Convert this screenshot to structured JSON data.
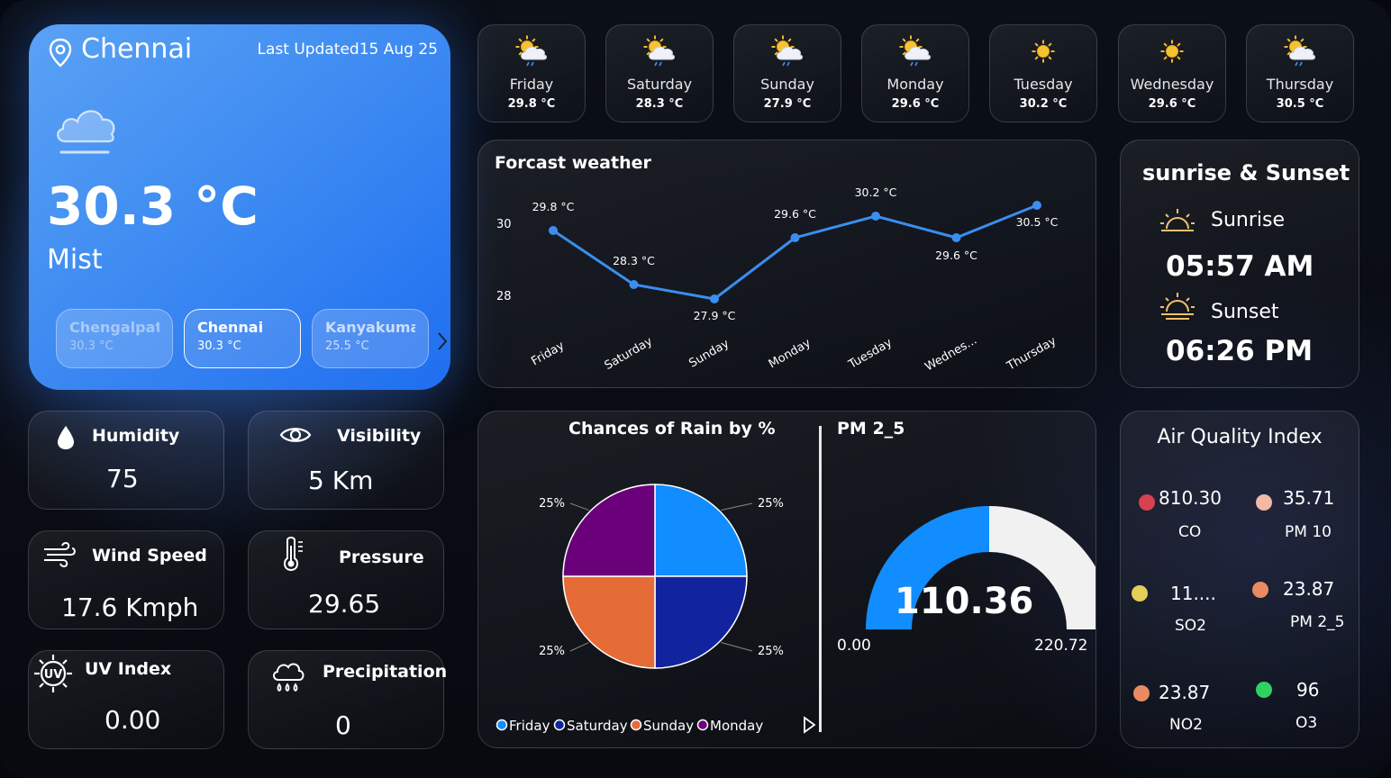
{
  "location": {
    "city": "Chennai",
    "last_updated": "Last Updated15 Aug 25",
    "temperature": "30.3 °C",
    "condition": "Mist",
    "cities": [
      {
        "name": "Chengalpat...",
        "temp": "30.3 °C"
      },
      {
        "name": "Chennai",
        "temp": "30.3 °C"
      },
      {
        "name": "Kanyakuma...",
        "temp": "25.5 °C"
      }
    ]
  },
  "stats": {
    "humidity": {
      "label": "Humidity",
      "value": "75"
    },
    "visibility": {
      "label": "Visibility",
      "value": "5 Km"
    },
    "wind": {
      "label": "Wind Speed",
      "value": "17.6 Kmph"
    },
    "pressure": {
      "label": "Pressure",
      "value": "29.65"
    },
    "uv": {
      "label": "UV Index",
      "value": "0.00"
    },
    "precipitation": {
      "label": "Precipitation",
      "value": "0"
    }
  },
  "days": [
    {
      "name": "Friday",
      "temp": "29.8 °C",
      "icon": "partly-cloudy-rain-icon"
    },
    {
      "name": "Saturday",
      "temp": "28.3 °C",
      "icon": "partly-cloudy-rain-icon"
    },
    {
      "name": "Sunday",
      "temp": "27.9 °C",
      "icon": "partly-cloudy-rain-icon"
    },
    {
      "name": "Monday",
      "temp": "29.6 °C",
      "icon": "partly-cloudy-rain-icon"
    },
    {
      "name": "Tuesday",
      "temp": "30.2 °C",
      "icon": "sun-icon"
    },
    {
      "name": "Wednesday",
      "temp": "29.6 °C",
      "icon": "sun-icon"
    },
    {
      "name": "Thursday",
      "temp": "30.5 °C",
      "icon": "partly-cloudy-rain-icon"
    }
  ],
  "forecast": {
    "title": "Forcast weather"
  },
  "rain": {
    "title": "Chances of Rain by %"
  },
  "pm": {
    "title": "PM 2_5",
    "value_label": "110.36",
    "min_label": "0.00",
    "max_label": "220.72"
  },
  "sun": {
    "title": "sunrise & Sunset",
    "sunrise_label": "Sunrise",
    "sunrise_time": "05:57 AM",
    "sunset_label": "Sunset",
    "sunset_time": "06:26 PM"
  },
  "aqi": {
    "title": "Air Quality Index",
    "items": [
      {
        "value": "810.30",
        "name": "CO",
        "color": "#d8414f"
      },
      {
        "value": "35.71",
        "name": "PM 10",
        "color": "#f2b9a4"
      },
      {
        "value": "11....",
        "name": "SO2",
        "color": "#e3cf58"
      },
      {
        "value": "23.87",
        "name": "PM 2_5",
        "color": "#ea8a63"
      },
      {
        "value": "23.87",
        "name": "NO2",
        "color": "#ea8a63"
      },
      {
        "value": "96",
        "name": "O3",
        "color": "#30d163"
      }
    ]
  },
  "chart_data": [
    {
      "type": "line",
      "title": "Forcast weather",
      "categories": [
        "Friday",
        "Saturday",
        "Sunday",
        "Monday",
        "Tuesday",
        "Wednes...",
        "Thursday"
      ],
      "values": [
        29.8,
        28.3,
        27.9,
        29.6,
        30.2,
        29.6,
        30.5
      ],
      "data_labels": [
        "29.8 °C",
        "28.3 °C",
        "27.9 °C",
        "29.6 °C",
        "30.2 °C",
        "29.6 °C",
        "30.5 °C"
      ],
      "yticks": [
        28,
        30
      ],
      "ylim": [
        26.9,
        31.0
      ],
      "color": "#3a8ef0"
    },
    {
      "type": "pie",
      "title": "Chances of Rain by %",
      "labels": [
        "Friday",
        "Saturday",
        "Sunday",
        "Monday"
      ],
      "values": [
        25,
        25,
        25,
        25
      ],
      "slice_order": [
        "Friday",
        "Saturday",
        "Sunday",
        "Monday"
      ],
      "data_labels": [
        "25%",
        "25%",
        "25%",
        "25%"
      ],
      "colors": [
        "#118dff",
        "#12239e",
        "#e66c37",
        "#6b007b"
      ],
      "legend_position": "bottom"
    },
    {
      "type": "gauge",
      "title": "PM 2_5",
      "value": 110.36,
      "min": 0,
      "max": 220.72,
      "colors": [
        "#118dff",
        "#f1f1f1"
      ]
    }
  ]
}
